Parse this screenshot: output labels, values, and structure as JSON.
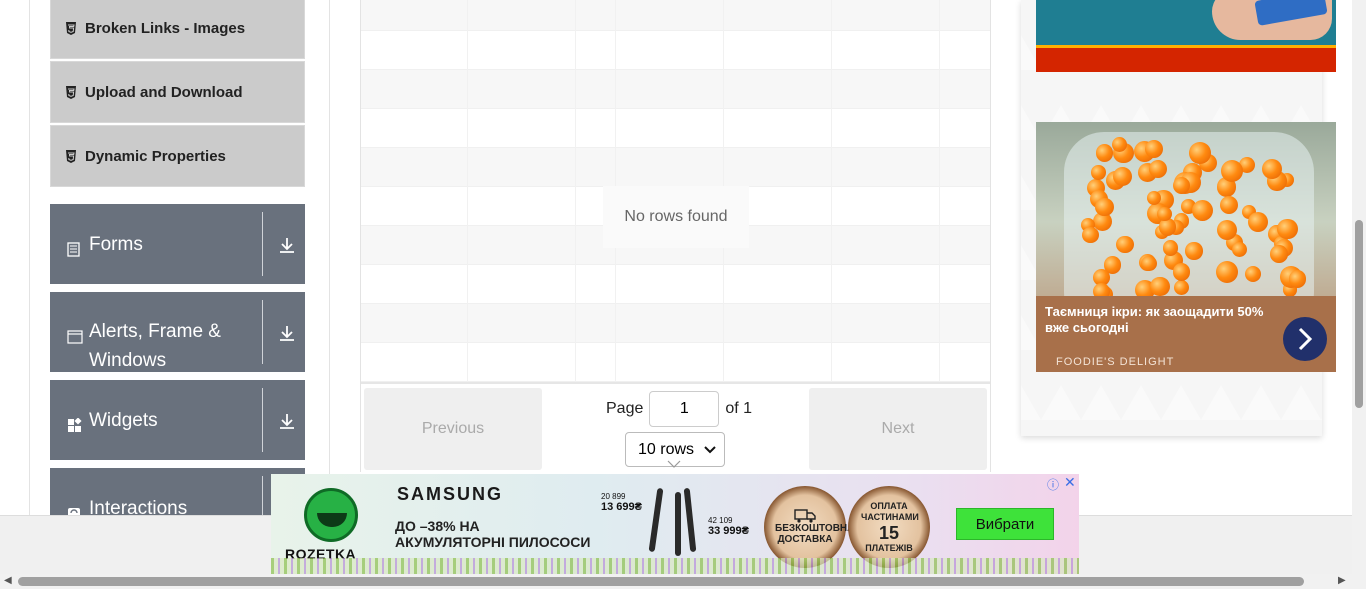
{
  "sidebar": {
    "sub_items": [
      {
        "label": "Broken Links - Images"
      },
      {
        "label": "Upload and Download"
      },
      {
        "label": "Dynamic Properties"
      }
    ],
    "groups": [
      {
        "label": "Forms",
        "icon": "form-icon"
      },
      {
        "label": "Alerts, Frame & Windows",
        "icon": "window-icon"
      },
      {
        "label": "Widgets",
        "icon": "widgets-icon"
      },
      {
        "label": "Interactions",
        "icon": "interactions-icon"
      }
    ]
  },
  "table": {
    "empty_message": "No rows found",
    "pagination": {
      "previous_label": "Previous",
      "next_label": "Next",
      "page_label": "Page",
      "current_page": "1",
      "of_label": "of 1",
      "rows_option": "10 rows"
    }
  },
  "ads": {
    "caviar": {
      "headline": "Таємниця ікри: як заощадити 50% вже сьогодні",
      "brand": "FOODIE'S DELIGHT"
    },
    "banner": {
      "store": "ROZETKA",
      "maker": "SAMSUNG",
      "promo_line1": "ДО –38% НА",
      "promo_line2": "АКУМУЛЯТОРНІ ПИЛОСОСИ",
      "price1_old": "20 899",
      "price1_new": "13 699₴",
      "price2_old": "42 109",
      "price2_new": "33 999₴",
      "badge1": "БЕЗКОШТОВНА ДОСТАВКА",
      "badge2_top": "ОПЛАТА ЧАСТИНАМИ",
      "badge2_num": "15",
      "badge2_bottom": "ПЛАТЕЖІВ",
      "cta": "Вибрати"
    }
  },
  "colors": {
    "group_bg": "#69717d",
    "sub_item_bg": "#cbcbcb",
    "cta_green": "#3ee23a"
  }
}
